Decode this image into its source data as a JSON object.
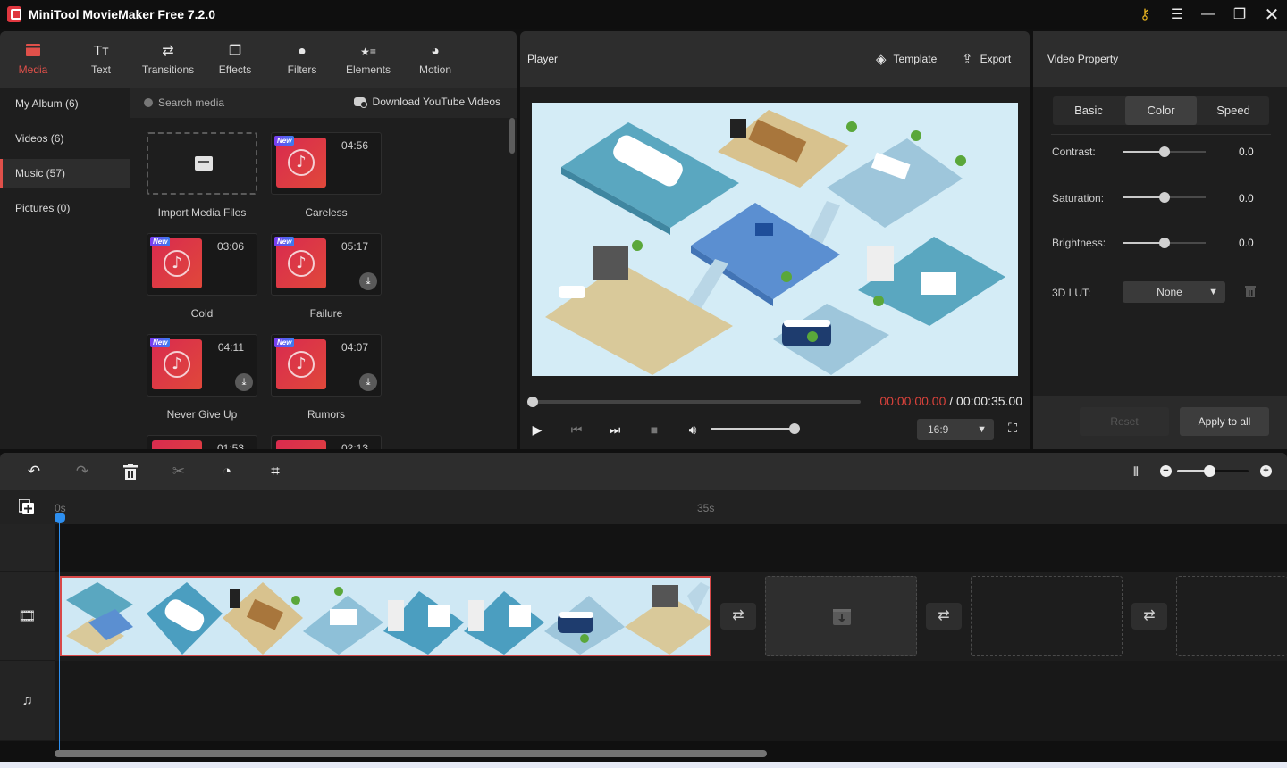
{
  "app": {
    "title": "MiniTool MovieMaker Free 7.2.0",
    "window_controls": [
      "key-icon",
      "menu-icon",
      "minimize-icon",
      "maximize-icon",
      "close-icon"
    ]
  },
  "main_tabs": [
    {
      "label": "Media",
      "icon": "media-folder-icon",
      "glyph": "▬",
      "active": true
    },
    {
      "label": "Text",
      "icon": "text-icon",
      "glyph": "Tт",
      "active": false
    },
    {
      "label": "Transitions",
      "icon": "transitions-icon",
      "glyph": "⇄",
      "active": false
    },
    {
      "label": "Effects",
      "icon": "effects-icon",
      "glyph": "❐",
      "active": false
    },
    {
      "label": "Filters",
      "icon": "filters-icon",
      "glyph": "●",
      "active": false
    },
    {
      "label": "Elements",
      "icon": "elements-icon",
      "glyph": "★≡",
      "active": false
    },
    {
      "label": "Motion",
      "icon": "motion-icon",
      "glyph": "◕",
      "active": false
    }
  ],
  "categories": [
    {
      "label": "My Album (6)",
      "active": false
    },
    {
      "label": "Videos (6)",
      "active": false
    },
    {
      "label": "Music (57)",
      "active": true
    },
    {
      "label": "Pictures (0)",
      "active": false
    }
  ],
  "media": {
    "search_placeholder": "Search media",
    "download_label": "Download YouTube Videos",
    "import_label": "Import Media Files",
    "new_badge": "New",
    "download_glyph": "⤓",
    "items": [
      {
        "name": "Careless",
        "duration": "04:56",
        "is_new": true,
        "needs_download": false
      },
      {
        "name": "Cold",
        "duration": "03:06",
        "is_new": true,
        "needs_download": false
      },
      {
        "name": "Failure",
        "duration": "05:17",
        "is_new": true,
        "needs_download": true
      },
      {
        "name": "Never Give Up",
        "duration": "04:11",
        "is_new": true,
        "needs_download": true
      },
      {
        "name": "Rumors",
        "duration": "04:07",
        "is_new": true,
        "needs_download": true
      },
      {
        "name": "",
        "duration": "01:53",
        "is_new": false,
        "needs_download": false
      },
      {
        "name": "",
        "duration": "02:13",
        "is_new": false,
        "needs_download": false
      }
    ]
  },
  "player": {
    "title": "Player",
    "template_label": "Template",
    "export_label": "Export",
    "time_current": "00:00:00.00",
    "time_separator": " / ",
    "time_total": "00:00:35.00",
    "progress": 0.0,
    "volume": 1.0,
    "aspect_ratio": "16:9",
    "chevron": "⌄"
  },
  "video_property": {
    "title": "Video Property",
    "tabs": [
      {
        "label": "Basic",
        "active": false
      },
      {
        "label": "Color",
        "active": true
      },
      {
        "label": "Speed",
        "active": false
      }
    ],
    "adjustments": [
      {
        "label": "Contrast:",
        "value": "0.0",
        "position": 0.5
      },
      {
        "label": "Saturation:",
        "value": "0.0",
        "position": 0.5
      },
      {
        "label": "Brightness:",
        "value": "0.0",
        "position": 0.5
      }
    ],
    "lut_label": "3D LUT:",
    "lut_value": "None",
    "reset_label": "Reset",
    "apply_all_label": "Apply to all"
  },
  "timeline": {
    "tools": [
      {
        "name": "undo-icon",
        "glyph": "↶",
        "enabled": true
      },
      {
        "name": "redo-icon",
        "glyph": "↷",
        "enabled": false
      },
      {
        "name": "delete-icon",
        "glyph": "🗑",
        "enabled": true
      },
      {
        "name": "split-icon",
        "glyph": "✂",
        "enabled": false
      },
      {
        "name": "speed-icon",
        "glyph": "◔",
        "enabled": true
      },
      {
        "name": "crop-icon",
        "glyph": "⌗",
        "enabled": true
      }
    ],
    "zoom_level": 0.45,
    "ruler_ticks": [
      "0s",
      "35s"
    ],
    "transition_glyph": "⇄",
    "track_icons": {
      "video": "🎞",
      "audio": "♫"
    }
  }
}
